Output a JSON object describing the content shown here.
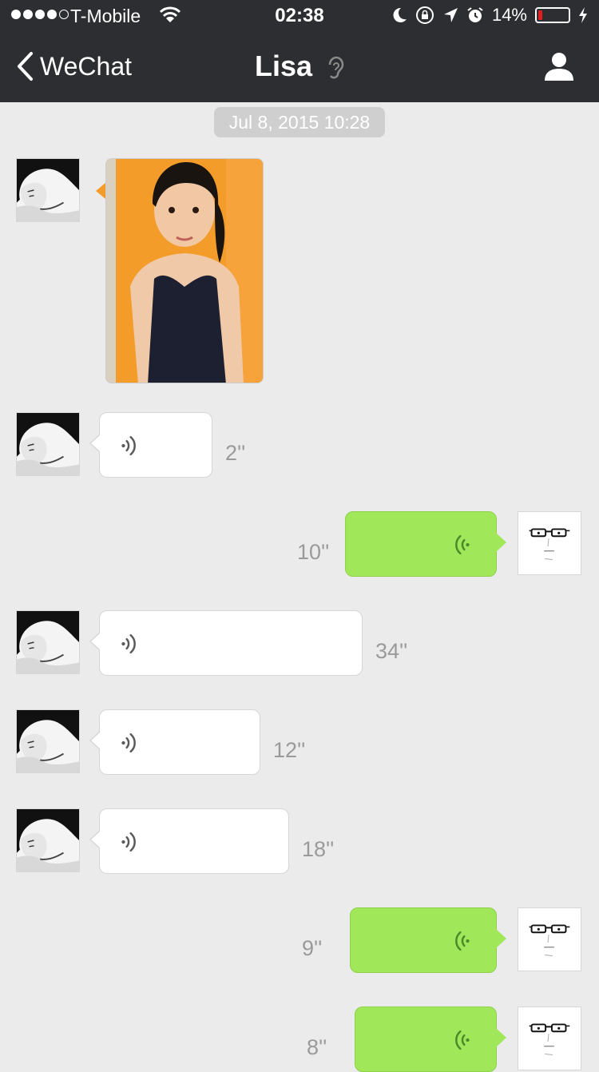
{
  "status_bar": {
    "carrier": "T-Mobile",
    "time": "02:38",
    "battery_percent": "14%",
    "battery_level": 0.14,
    "signal_bars_filled": 4,
    "signal_bars_total": 5,
    "icons": [
      "wifi-icon",
      "moon-icon",
      "rotation-lock-icon",
      "location-arrow-icon",
      "alarm-icon",
      "battery-icon",
      "charging-bolt-icon"
    ]
  },
  "nav": {
    "back_label": "WeChat",
    "title": "Lisa",
    "title_icon": "ear-icon",
    "right_icon": "profile-icon"
  },
  "chat": {
    "timestamp": "Jul 8, 2015 10:28",
    "messages": [
      {
        "type": "image",
        "from": "incoming",
        "content": "photo of a young woman in front of an orange wall"
      },
      {
        "type": "voice",
        "from": "incoming",
        "duration": "2''"
      },
      {
        "type": "voice",
        "from": "outgoing",
        "duration": "10''"
      },
      {
        "type": "voice",
        "from": "incoming",
        "duration": "34''"
      },
      {
        "type": "voice",
        "from": "incoming",
        "duration": "12''"
      },
      {
        "type": "voice",
        "from": "incoming",
        "duration": "18''"
      },
      {
        "type": "voice",
        "from": "outgoing",
        "duration": "9''"
      },
      {
        "type": "voice",
        "from": "outgoing",
        "duration": "8''"
      }
    ]
  },
  "colors": {
    "nav_bg": "#2d2e31",
    "chat_bg": "#ebebeb",
    "outgoing_bubble": "#a0e75a",
    "incoming_bubble": "#ffffff",
    "voice_icon_in": "#5a5a5a",
    "voice_icon_out": "#4a8a2a"
  }
}
